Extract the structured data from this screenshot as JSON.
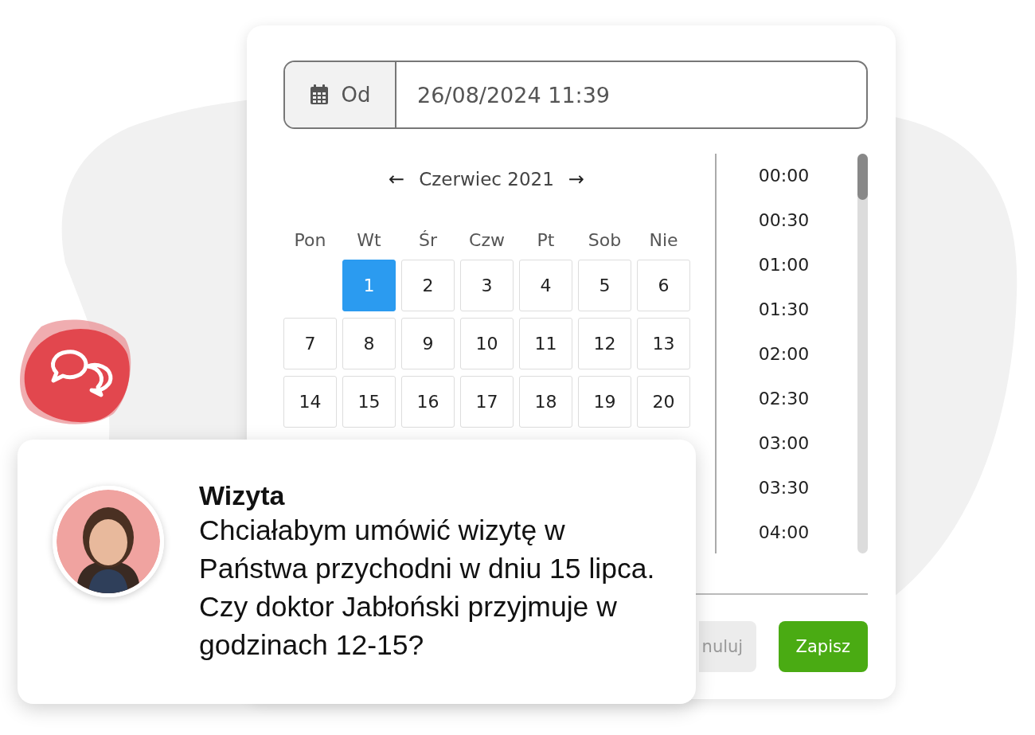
{
  "date_field": {
    "label": "Od",
    "value": "26/08/2024 11:39"
  },
  "calendar": {
    "prev": "←",
    "month": "Czerwiec 2021",
    "next": "→",
    "weekdays": [
      "Pon",
      "Wt",
      "Śr",
      "Czw",
      "Pt",
      "Sob",
      "Nie"
    ],
    "weeks": [
      [
        {
          "kind": "blank"
        },
        {
          "kind": "day",
          "label": "1",
          "selected": true
        },
        {
          "kind": "day",
          "label": "2",
          "selected": false
        },
        {
          "kind": "day",
          "label": "3",
          "selected": false
        },
        {
          "kind": "day",
          "label": "4",
          "selected": false
        },
        {
          "kind": "day",
          "label": "5",
          "selected": false
        },
        {
          "kind": "day",
          "label": "6",
          "selected": false
        }
      ],
      [
        {
          "kind": "day",
          "label": "7",
          "selected": false
        },
        {
          "kind": "day",
          "label": "8",
          "selected": false
        },
        {
          "kind": "day",
          "label": "9",
          "selected": false
        },
        {
          "kind": "day",
          "label": "10",
          "selected": false
        },
        {
          "kind": "day",
          "label": "11",
          "selected": false
        },
        {
          "kind": "day",
          "label": "12",
          "selected": false
        },
        {
          "kind": "day",
          "label": "13",
          "selected": false
        }
      ],
      [
        {
          "kind": "day",
          "label": "14",
          "selected": false
        },
        {
          "kind": "day",
          "label": "15",
          "selected": false
        },
        {
          "kind": "day",
          "label": "16",
          "selected": false
        },
        {
          "kind": "day",
          "label": "17",
          "selected": false
        },
        {
          "kind": "day",
          "label": "18",
          "selected": false
        },
        {
          "kind": "day",
          "label": "19",
          "selected": false
        },
        {
          "kind": "day",
          "label": "20",
          "selected": false
        }
      ]
    ]
  },
  "times": [
    "00:00",
    "00:30",
    "01:00",
    "01:30",
    "02:00",
    "02:30",
    "03:00",
    "03:30",
    "04:00"
  ],
  "buttons": [
    {
      "kind": "cancel",
      "label": "nuluj",
      "disabled": true
    },
    {
      "kind": "save",
      "label": "Zapisz",
      "disabled": false
    }
  ],
  "message": {
    "title": "Wizyta",
    "text": "Chciałabym umówić wizytę w Państwa przychodni w dniu 15 lipca. Czy doktor Jabłoński przyjmuje w godzinach 12-15?"
  }
}
